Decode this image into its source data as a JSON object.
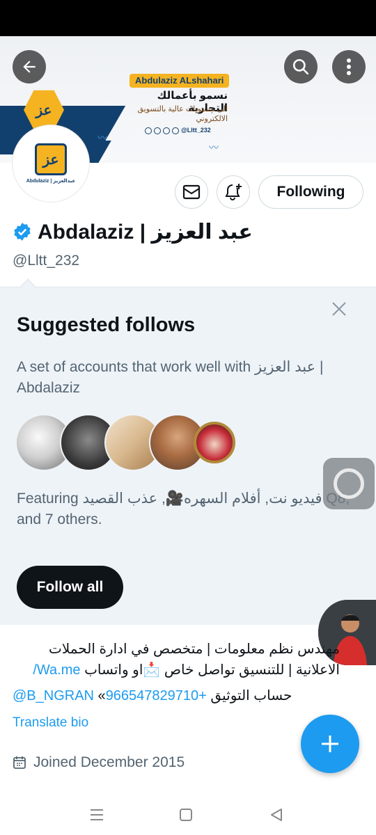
{
  "banner": {
    "brand_name": "Abdulaziz ALshahari",
    "tagline_main": "نسمو بأعمالك التجارية",
    "tagline_sub1": "الى مستويات عالية بالتسويق",
    "tagline_sub2": "الالكتروني",
    "social_handle": "@Lltt_232",
    "hex_mark": "عز"
  },
  "avatar": {
    "mark": "عز",
    "caption": "Abdulaziz | عبدالعزيز"
  },
  "profile": {
    "display_name": "Abdalaziz | عبد العزيز",
    "handle": "@Lltt_232",
    "following_label": "Following",
    "verified_color": "#1d9bf0"
  },
  "suggested": {
    "title": "Suggested follows",
    "description": "A set of accounts that work well with عبد العزيز | Abdalaziz",
    "featuring": "Featuring فيديو نت, أفلام السهره🎥, عذب القصيد Q8, and 7 others.",
    "follow_all_label": "Follow all"
  },
  "bio": {
    "line1": "مهندس نظم معلومات | متخصص في ادارة الحملات",
    "line2_text": "الاعلانية | للتنسيق تواصل خاص 📩او واتساب ",
    "line2_link": "Wa.me/",
    "line3_link1": "@B_NGRAN",
    "line3_text": " «حساب التوثيق ",
    "line3_link2": "+966547829710",
    "translate_label": "Translate bio",
    "joined": "Joined December 2015"
  },
  "icons": {
    "back": "back-arrow-icon",
    "search": "search-icon",
    "more": "more-vertical-icon",
    "message": "envelope-icon",
    "notify": "bell-plus-icon",
    "close": "close-icon",
    "calendar": "calendar-icon",
    "compose": "plus-icon"
  },
  "colors": {
    "accent": "#1d9bf0",
    "brand_navy": "#12406e",
    "brand_gold": "#f5b321"
  }
}
